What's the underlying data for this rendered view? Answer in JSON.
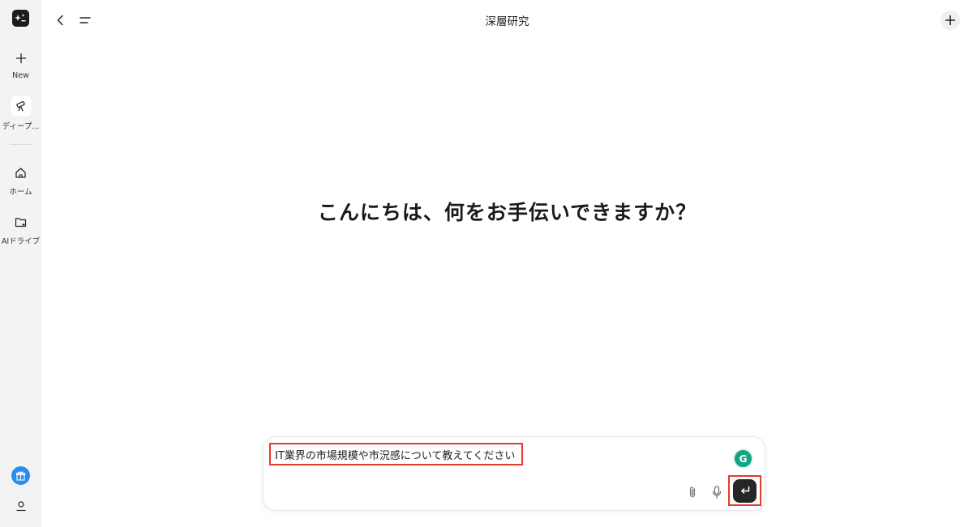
{
  "sidebar": {
    "items": [
      {
        "label": "New",
        "icon": "plus-icon"
      },
      {
        "label": "ディープ...",
        "icon": "telescope-icon"
      },
      {
        "label": "ホーム",
        "icon": "home-icon"
      },
      {
        "label": "AIドライブ",
        "icon": "folder-icon"
      }
    ],
    "logo_icon": "app-logo-icon",
    "gift_icon": "gift-icon",
    "profile_icon": "user-icon"
  },
  "header": {
    "title": "深層研究",
    "back_icon": "chevron-left-icon",
    "menu_icon": "menu-icon",
    "new_icon": "plus-icon"
  },
  "main": {
    "greeting": "こんにちは、何をお手伝いできますか？"
  },
  "composer": {
    "input_value": "IT業界の市場規模や市況感について教えてください",
    "grammarly_letter": "G",
    "highlight_color": "#e53a2e"
  },
  "colors": {
    "accent_blue": "#2b8cf0",
    "send_button": "#262626",
    "sidebar_bg": "#f3f3f3"
  }
}
